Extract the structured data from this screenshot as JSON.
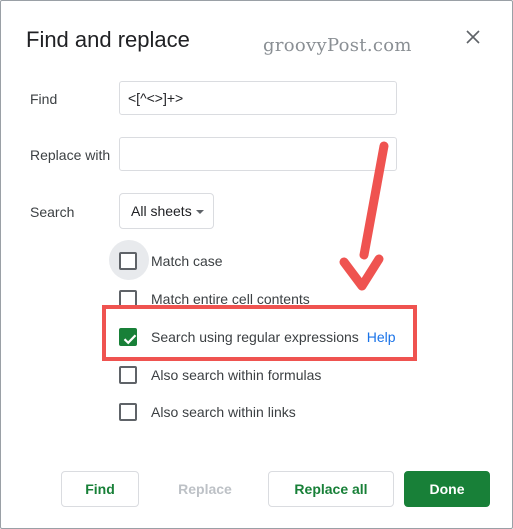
{
  "dialog": {
    "title": "Find and replace"
  },
  "watermark": "groovyPost.com",
  "find": {
    "label": "Find",
    "value": "<[^<>]+>"
  },
  "replace": {
    "label": "Replace with",
    "value": ""
  },
  "search": {
    "label": "Search",
    "selected": "All sheets"
  },
  "options": {
    "match_case": {
      "label": "Match case",
      "checked": false
    },
    "match_entire": {
      "label": "Match entire cell contents",
      "checked": false
    },
    "regex": {
      "label": "Search using regular expressions",
      "checked": true,
      "help": "Help"
    },
    "formulas": {
      "label": "Also search within formulas",
      "checked": false
    },
    "links": {
      "label": "Also search within links",
      "checked": false
    }
  },
  "buttons": {
    "find": "Find",
    "replace": "Replace",
    "replace_all": "Replace all",
    "done": "Done"
  },
  "colors": {
    "accent": "#188038",
    "link": "#1a73e8",
    "annotation": "#ef5350"
  }
}
